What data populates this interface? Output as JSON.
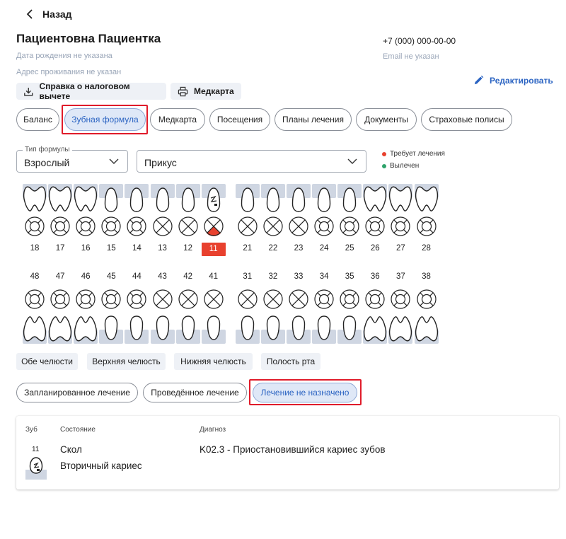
{
  "nav": {
    "back_label": "Назад"
  },
  "patient": {
    "name": "Пациентовна Пациентка",
    "birth_date": "Дата рождения не указана",
    "address": "Адрес проживания не указан",
    "phone": "+7 (000) 000-00-00",
    "email": "Email не указан"
  },
  "actions": {
    "tax_certificate": "Справка о налоговом вычете",
    "medcard": "Медкарта",
    "edit": "Редактировать"
  },
  "tabs": [
    "Баланс",
    "Зубная формула",
    "Медкарта",
    "Посещения",
    "Планы лечения",
    "Документы",
    "Страховые полисы"
  ],
  "active_tab": "Зубная формула",
  "filters": {
    "formula_type": {
      "label": "Тип формулы",
      "value": "Взрослый"
    },
    "bite": {
      "value": "Прикус"
    }
  },
  "legend": [
    {
      "label": "Требует лечения",
      "color": "#e8412e"
    },
    {
      "label": "Вылечен",
      "color": "#2ea36b"
    }
  ],
  "upper_teeth": [
    "18",
    "17",
    "16",
    "15",
    "14",
    "13",
    "12",
    "11",
    "21",
    "22",
    "23",
    "24",
    "25",
    "26",
    "27",
    "28"
  ],
  "lower_teeth": [
    "48",
    "47",
    "46",
    "45",
    "44",
    "43",
    "42",
    "41",
    "31",
    "32",
    "33",
    "34",
    "35",
    "36",
    "37",
    "38"
  ],
  "selected_tooth": "11",
  "jaw_filters": [
    "Обе челюсти",
    "Верхняя челюсть",
    "Нижняя челюсть",
    "Полость рта"
  ],
  "treatment_filters": [
    "Запланированное лечение",
    "Проведённое лечение",
    "Лечение не назначено"
  ],
  "active_treatment_filter": "Лечение не назначено",
  "table": {
    "headers": {
      "tooth": "Зуб",
      "state": "Состояние",
      "diagnosis": "Диагноз"
    },
    "rows": [
      {
        "tooth": "11",
        "state_line1": "Скол",
        "state_line2": "Вторичный кариес",
        "diagnosis": "K02.3 - Приостановившийся кариес зубов"
      }
    ]
  },
  "colors": {
    "accent": "#2a63c2",
    "highlight": "#e01b2a",
    "gum": "#cfd6e2",
    "needs_treatment": "#e8412e"
  }
}
